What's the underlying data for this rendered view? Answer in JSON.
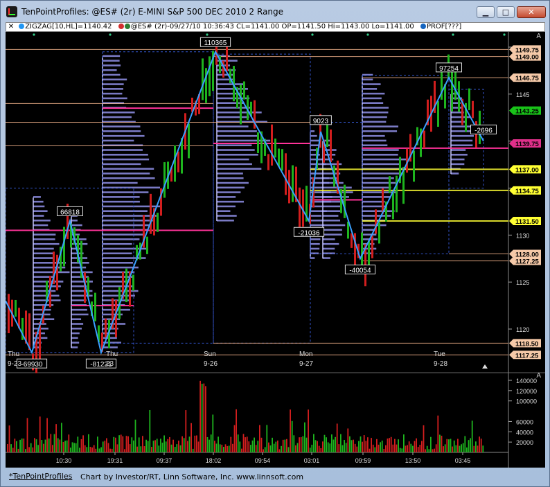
{
  "window": {
    "title": "TenPointProfiles: @ES# (2r)  E-MINI S&P 500 DEC 2010  2 Range",
    "minimize_glyph": "▁",
    "maximize_glyph": "□",
    "close_glyph": "✕"
  },
  "infobar": {
    "close_glyph": "✕",
    "study_zigzag": "ZIGZAG[10,HL]=1140.42",
    "quote": "@ES# (2r)-09/27/10 10:36:43 CL=1141.00 OP=1141.50 Hi=1143.00 Lo=1141.00",
    "study_prof": "PROF[???]",
    "colors": {
      "zigzag": "#2196f3",
      "quote_a": "#d32f2f",
      "quote_b": "#2e7d32",
      "prof": "#1565c0"
    }
  },
  "panes": {
    "price_pane_letter": "A",
    "volume_pane_letter": "A"
  },
  "price_axis": {
    "ticks": [
      "1150",
      "1145",
      "1140",
      "1135",
      "1130",
      "1125",
      "1120"
    ]
  },
  "price_tags": [
    {
      "label": "1149.75",
      "color": "#f5c9a8"
    },
    {
      "label": "1149.00",
      "color": "#f5c9a8"
    },
    {
      "label": "1146.75",
      "color": "#f5c9a8"
    },
    {
      "label": "1143.25",
      "color": "#19c319"
    },
    {
      "label": "1139.75",
      "color": "#e0308a"
    },
    {
      "label": "1137.00",
      "color": "#ffff33"
    },
    {
      "label": "1134.75",
      "color": "#ffff33"
    },
    {
      "label": "1131.50",
      "color": "#ffff33"
    },
    {
      "label": "1128.00",
      "color": "#f5c9a8"
    },
    {
      "label": "1127.25",
      "color": "#f5c9a8"
    },
    {
      "label": "1118.50",
      "color": "#f5c9a8"
    },
    {
      "label": "1117.25",
      "color": "#f5c9a8"
    }
  ],
  "zigzag_labels": [
    "-69930",
    "66818",
    "-81221",
    "110365",
    "-21036",
    "9023",
    "-40054",
    "97254",
    "-2696"
  ],
  "day_labels": [
    {
      "day": "Thu",
      "date": "9-23"
    },
    {
      "day": "Thu",
      "date": "23"
    },
    {
      "day": "Sun",
      "date": "9-26"
    },
    {
      "day": "Mon",
      "date": "9-27"
    },
    {
      "day": "Tue",
      "date": "9-28"
    }
  ],
  "volume_axis": {
    "ticks": [
      "140000",
      "120000",
      "100000",
      "60000",
      "40000",
      "20000"
    ]
  },
  "time_axis": {
    "ticks": [
      "10:30",
      "19:31",
      "09:37",
      "18:02",
      "09:54",
      "03:01",
      "09:59",
      "13:50",
      "03:45"
    ]
  },
  "footer": {
    "tab": "*TenPointProfiles",
    "credit": "Chart by Investor/RT, Linn Software, Inc.  www.linnsoft.com"
  },
  "colors": {
    "background": "#000000",
    "up_bar": "#1eb41e",
    "down_bar": "#d21e1e",
    "zigzag": "#3aa0ff",
    "profile": "#8f8fe6",
    "value_area": "#ff3399",
    "yellow_level": "#ffff33",
    "salmon_level": "#f5b48c"
  }
}
